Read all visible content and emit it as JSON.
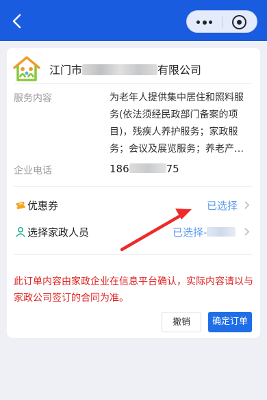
{
  "nav": {
    "back_icon": "chevron-left-icon",
    "more_icon": "more-dots-icon",
    "close_icon": "target-circle-icon"
  },
  "company": {
    "name_prefix": "江门市",
    "name_suffix": "有限公司",
    "logo_icon": "home-family-logo"
  },
  "service": {
    "label": "服务内容",
    "lines": [
      "为老年人提供集中居住和照料服",
      "务(依法须经民政部门备案的项",
      "目)，残疾人养护服务；家政服",
      "务；会议及展览服务；养老产…"
    ]
  },
  "phone": {
    "label": "企业电话",
    "prefix": "186",
    "suffix": "75"
  },
  "coupon": {
    "title": "优惠券",
    "value": "已选择",
    "icon": "coupon-icon"
  },
  "staff": {
    "title": "选择家政人员",
    "value": "已选择-",
    "icon": "person-icon"
  },
  "notice": {
    "lines": [
      "此订单内容由家政企业在信息平台确认，实际内容请以与",
      "家政公司签订的合同为准。"
    ],
    "color": "#e02020"
  },
  "actions": {
    "cancel_label": "撤销",
    "confirm_label": "确定订单"
  },
  "colors": {
    "header": "#1a5ce0",
    "accent": "#1f6ee8",
    "link": "#5b9bf0",
    "annotation_arrow": "#ee2a2a"
  }
}
